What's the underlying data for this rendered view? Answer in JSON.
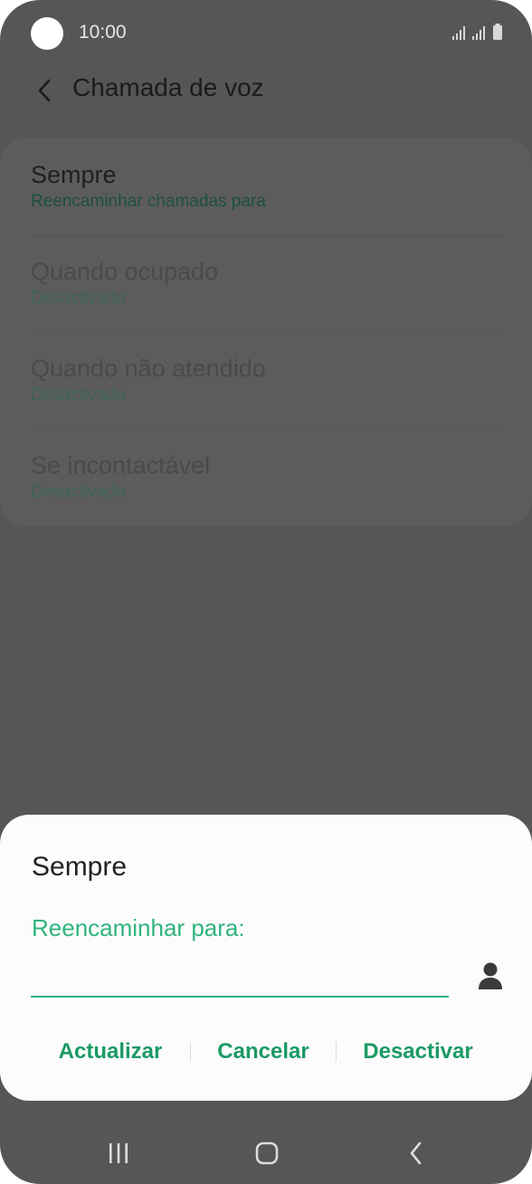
{
  "status_bar": {
    "time": "10:00"
  },
  "app_bar": {
    "title": "Chamada de voz"
  },
  "list": [
    {
      "title": "Sempre",
      "subtitle": "Reencaminhar chamadas para"
    },
    {
      "title": "Quando ocupado",
      "subtitle": "Desactivado"
    },
    {
      "title": "Quando não atendido",
      "subtitle": "Desactivado"
    },
    {
      "title": "Se incontactável",
      "subtitle": "Desactivado"
    }
  ],
  "dialog": {
    "title": "Sempre",
    "label": "Reencaminhar para:",
    "input_value": "",
    "buttons": {
      "update": "Actualizar",
      "cancel": "Cancelar",
      "deactivate": "Desactivar"
    }
  },
  "colors": {
    "accent": "#2fb47d",
    "button_text": "#1a9a64",
    "scrim": "#565656",
    "dialog_bg": "#fcfcfc"
  },
  "icons": [
    "camera-cutout",
    "signal-icon",
    "battery-icon",
    "back-arrow-icon",
    "contact-icon",
    "recents-icon",
    "home-icon",
    "nav-back-icon"
  ]
}
